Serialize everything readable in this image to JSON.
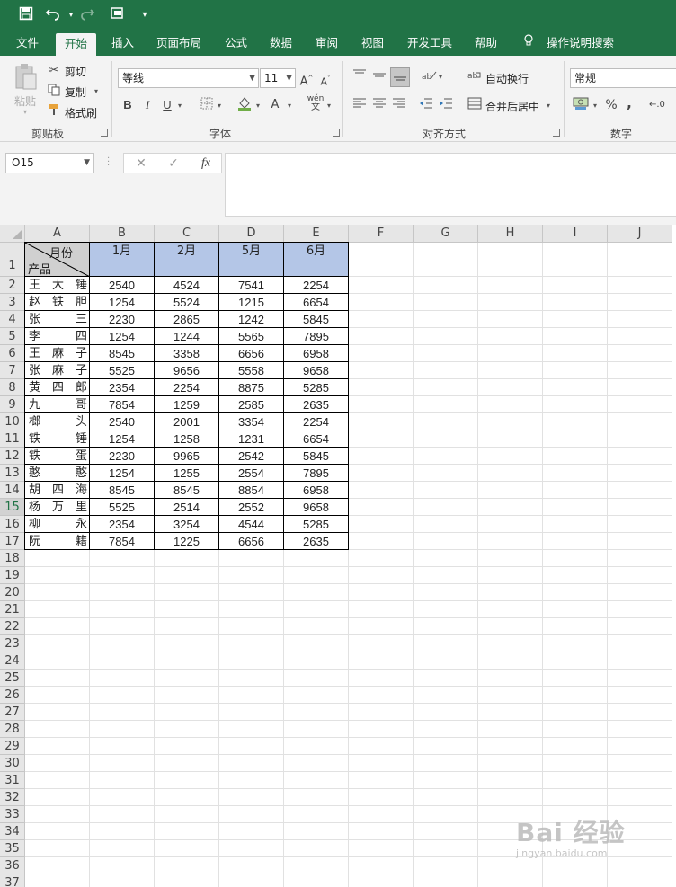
{
  "quick_access": {
    "save_icon": "save-icon",
    "undo_icon": "undo-icon",
    "redo_icon": "redo-icon",
    "preview_icon": "print-preview-icon",
    "customize_icon": "customize-icon"
  },
  "tabs": [
    "文件",
    "开始",
    "插入",
    "页面布局",
    "公式",
    "数据",
    "审阅",
    "视图",
    "开发工具",
    "帮助"
  ],
  "search_label": "操作说明搜索",
  "ribbon": {
    "paste": "粘贴",
    "cut": "剪切",
    "copy": "复制",
    "format_painter": "格式刷",
    "clipboard_label": "剪贴板",
    "font_name": "等线",
    "font_size": "11",
    "font_label": "字体",
    "bold": "B",
    "italic": "I",
    "underline": "U",
    "font_color": "A",
    "wen": "wén",
    "wrap_text": "自动换行",
    "merge_center": "合并后居中",
    "alignment_label": "对齐方式",
    "number_format": "常规",
    "percent": "%",
    "comma": ",",
    "number_label": "数字"
  },
  "formula_bar": {
    "name_box": "O15",
    "cancel": "✕",
    "enter": "✓",
    "fx": "fx",
    "content": ""
  },
  "columns": [
    "A",
    "B",
    "C",
    "D",
    "E",
    "F",
    "G",
    "H",
    "I",
    "J"
  ],
  "header_row": {
    "diag_top": "月份",
    "diag_bottom": "产品",
    "months": [
      "1月",
      "2月",
      "5月",
      "6月"
    ]
  },
  "rows": [
    {
      "name": "王大锤",
      "values": [
        2540,
        4524,
        7541,
        2254
      ]
    },
    {
      "name": "赵铁胆",
      "values": [
        1254,
        5524,
        1215,
        6654
      ]
    },
    {
      "name": "张三",
      "values": [
        2230,
        2865,
        1242,
        5845
      ]
    },
    {
      "name": "李四",
      "values": [
        1254,
        1244,
        5565,
        7895
      ]
    },
    {
      "name": "王麻子",
      "values": [
        8545,
        3358,
        6656,
        6958
      ]
    },
    {
      "name": "张麻子",
      "values": [
        5525,
        9656,
        5558,
        9658
      ]
    },
    {
      "name": "黄四郎",
      "values": [
        2354,
        2254,
        8875,
        5285
      ]
    },
    {
      "name": "九哥",
      "values": [
        7854,
        1259,
        2585,
        2635
      ]
    },
    {
      "name": "榔头",
      "values": [
        2540,
        2001,
        3354,
        2254
      ]
    },
    {
      "name": "铁锤",
      "values": [
        1254,
        1258,
        1231,
        6654
      ]
    },
    {
      "name": "铁蛋",
      "values": [
        2230,
        9965,
        2542,
        5845
      ]
    },
    {
      "name": "憨憨",
      "values": [
        1254,
        1255,
        2554,
        7895
      ]
    },
    {
      "name": "胡四海",
      "values": [
        8545,
        8545,
        8854,
        6958
      ]
    },
    {
      "name": "杨万里",
      "values": [
        5525,
        2514,
        2552,
        9658
      ]
    },
    {
      "name": "柳永",
      "values": [
        2354,
        3254,
        4544,
        5285
      ]
    },
    {
      "name": "阮籍",
      "values": [
        7854,
        1225,
        6656,
        2635
      ]
    }
  ],
  "selected_row": 15,
  "total_rows": 37,
  "watermark": {
    "big": "Bai 经验",
    "small": "jingyan.baidu.com"
  },
  "colors": {
    "excel_green": "#217346",
    "header_fill": "#b4c6e7"
  }
}
